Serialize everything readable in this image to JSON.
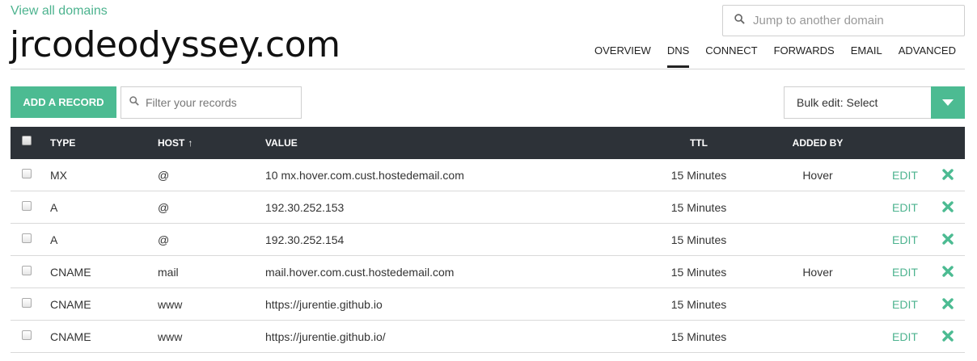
{
  "header": {
    "view_all": "View all domains",
    "domain": "jrcodeodyssey.com",
    "jump_placeholder": "Jump to another domain",
    "tabs": [
      {
        "label": "OVERVIEW"
      },
      {
        "label": "DNS"
      },
      {
        "label": "CONNECT"
      },
      {
        "label": "FORWARDS"
      },
      {
        "label": "EMAIL"
      },
      {
        "label": "ADVANCED"
      }
    ],
    "active_tab": "DNS"
  },
  "toolbar": {
    "add_label": "ADD A RECORD",
    "filter_placeholder": "Filter your records",
    "bulk_label": "Bulk edit: Select"
  },
  "table": {
    "columns": {
      "type": "TYPE",
      "host": "HOST",
      "host_sort_arrow": "↑",
      "value": "VALUE",
      "ttl": "TTL",
      "added_by": "ADDED BY"
    },
    "edit_label": "EDIT",
    "rows": [
      {
        "type": "MX",
        "host": "@",
        "value": "10 mx.hover.com.cust.hostedemail.com",
        "ttl": "15 Minutes",
        "added_by": "Hover"
      },
      {
        "type": "A",
        "host": "@",
        "value": "192.30.252.153",
        "ttl": "15 Minutes",
        "added_by": ""
      },
      {
        "type": "A",
        "host": "@",
        "value": "192.30.252.154",
        "ttl": "15 Minutes",
        "added_by": ""
      },
      {
        "type": "CNAME",
        "host": "mail",
        "value": "mail.hover.com.cust.hostedemail.com",
        "ttl": "15 Minutes",
        "added_by": "Hover"
      },
      {
        "type": "CNAME",
        "host": "www",
        "value": "https://jurentie.github.io",
        "ttl": "15 Minutes",
        "added_by": ""
      },
      {
        "type": "CNAME",
        "host": "www",
        "value": "https://jurentie.github.io/",
        "ttl": "15 Minutes",
        "added_by": ""
      }
    ]
  },
  "icons": {
    "search": "search-icon",
    "dropdown": "chevron-down-icon",
    "delete": "close-icon"
  },
  "colors": {
    "accent": "#4cbb92",
    "header_bg": "#2d3238",
    "link": "#4db38f"
  }
}
